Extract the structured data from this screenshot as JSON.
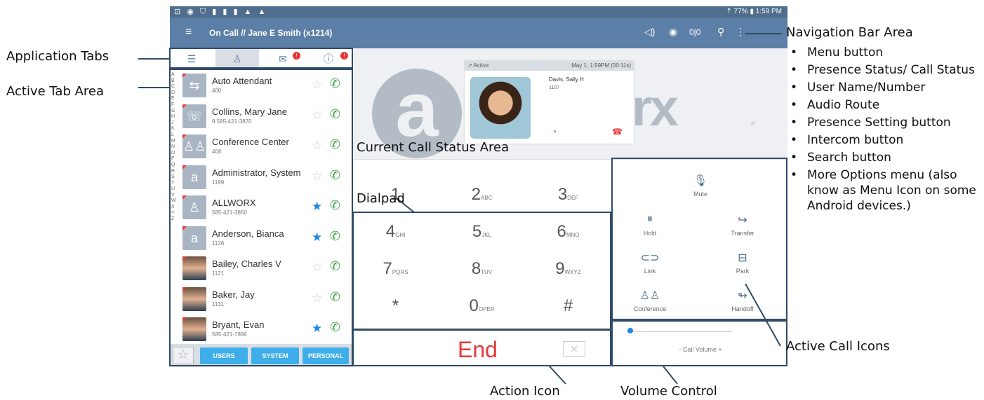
{
  "status_bar": {
    "left_icons": "⊡ ◉ ⛉ ▮ ▮ ▮ ▲ ▲",
    "right": "⇡ 77% ▮ 1:59 PM"
  },
  "nav": {
    "title": "On Call  //  Jane E Smith (x1214)"
  },
  "tabs": [
    {
      "name": "list"
    },
    {
      "name": "contacts"
    },
    {
      "name": "messages",
      "badge": "!"
    },
    {
      "name": "info",
      "badge": "!"
    }
  ],
  "alphabet": [
    "A",
    "B",
    "C",
    "D",
    "E",
    "F",
    "G",
    "H",
    "",
    "J",
    "K",
    "L",
    "M",
    "N",
    "O",
    "P",
    "Q",
    "R",
    "S",
    "T",
    "U",
    "V",
    "W",
    "X",
    "Y",
    "Z"
  ],
  "contacts": [
    {
      "name": "Auto Attendant",
      "number": "400",
      "fav": false
    },
    {
      "name": "Collins, Mary Jane",
      "number": "9 585-421-3870",
      "fav": false
    },
    {
      "name": "Conference Center",
      "number": "408",
      "fav": false
    },
    {
      "name": "Administrator, System",
      "number": "1199",
      "fav": false
    },
    {
      "name": "ALLWORX",
      "number": "585-421-3850",
      "fav": true
    },
    {
      "name": "Anderson, Bianca",
      "number": "1126",
      "fav": true
    },
    {
      "name": "Bailey, Charles V",
      "number": "1121",
      "fav": false
    },
    {
      "name": "Baker, Jay",
      "number": "1131",
      "fav": false
    },
    {
      "name": "Bryant, Evan",
      "number": "585-421-7896",
      "fav": true
    }
  ],
  "bottom_tabs": [
    "USERS",
    "SYSTEM",
    "PERSONAL"
  ],
  "call_card": {
    "status": "Active",
    "time": "May 1, 1:59PM (00:11s)",
    "caller": "Davis, Sally H",
    "ext": "1107"
  },
  "logo": {
    "letter": "a",
    "suffix": "rx",
    "reg": "®"
  },
  "dialpad": [
    {
      "digit": "1",
      "letters": ""
    },
    {
      "digit": "2",
      "letters": "ABC"
    },
    {
      "digit": "3",
      "letters": "DEF"
    },
    {
      "digit": "4",
      "letters": "GHI"
    },
    {
      "digit": "5",
      "letters": "JKL"
    },
    {
      "digit": "6",
      "letters": "MNO"
    },
    {
      "digit": "7",
      "letters": "PQRS"
    },
    {
      "digit": "8",
      "letters": "TUV"
    },
    {
      "digit": "9",
      "letters": "WXYZ"
    },
    {
      "digit": "*",
      "letters": ""
    },
    {
      "digit": "0",
      "letters": "OPER"
    },
    {
      "digit": "#",
      "letters": ""
    }
  ],
  "end_label": "End",
  "call_icons": {
    "mute": "Mute",
    "hold": "Hold",
    "transfer": "Transfer",
    "link": "Link",
    "park": "Park",
    "conference": "Conference",
    "handoff": "Handoff"
  },
  "volume": {
    "label": "- Call Volume +",
    "level": 0.03
  },
  "annotations": {
    "application_tabs": "Application Tabs",
    "active_tab_area": "Active Tab Area",
    "current_call_status": "Current Call Status Area",
    "dialpad": "Dialpad",
    "action_icon": "Action Icon",
    "volume_control": "Volume Control",
    "active_call_icons": "Active Call Icons",
    "navigation_bar": "Navigation Bar Area",
    "nav_bullets": [
      "Menu button",
      "Presence Status/ Call Status",
      "User Name/Number",
      "Audio Route",
      "Presence Setting button",
      "Intercom button",
      "Search button",
      "More Options menu (also know as Menu Icon on some Android devices.)"
    ]
  }
}
